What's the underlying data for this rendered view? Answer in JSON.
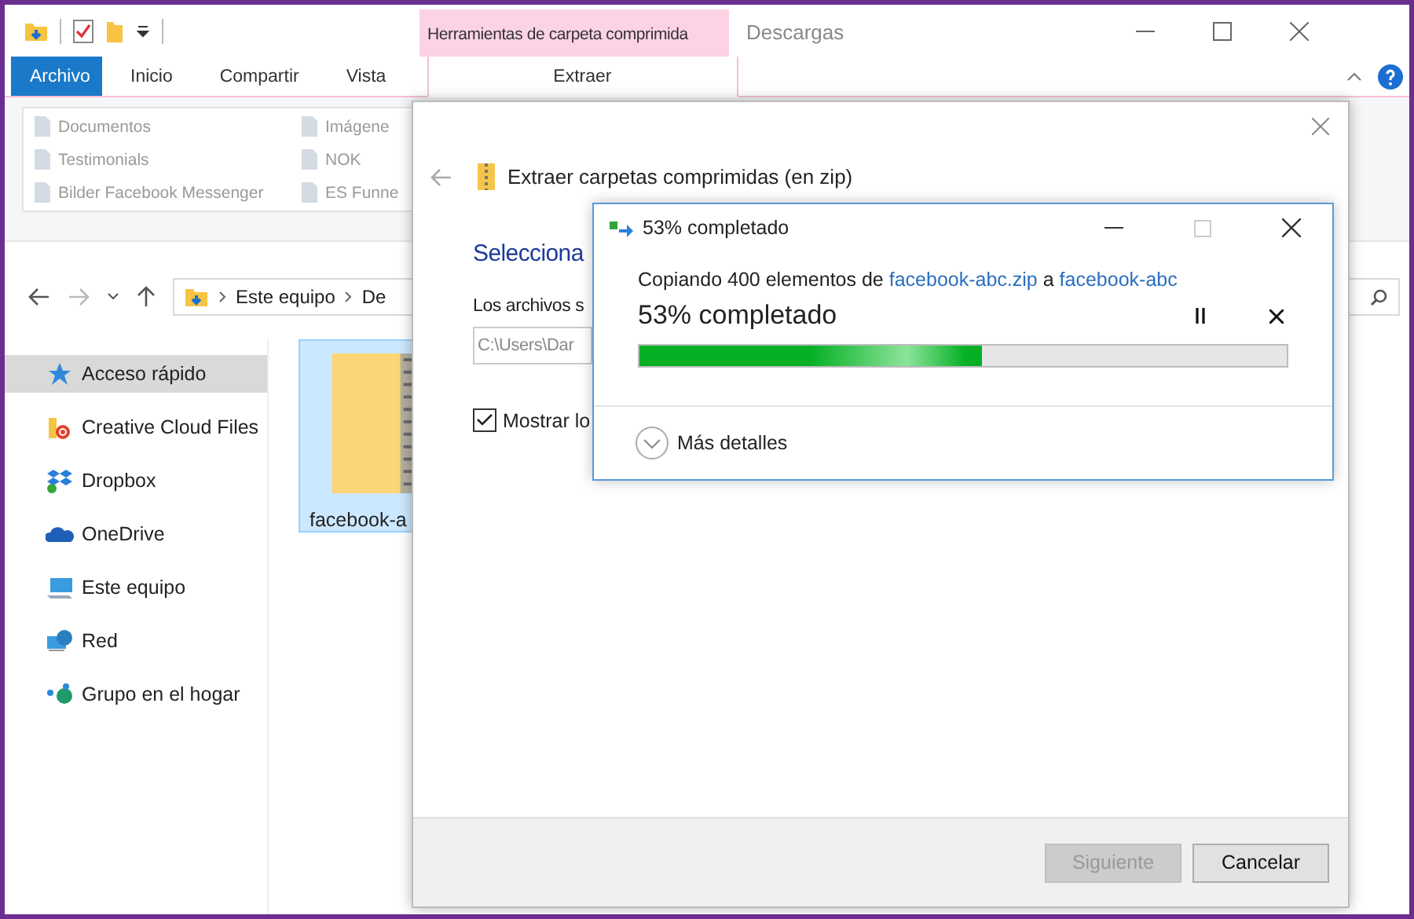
{
  "explorer": {
    "title": "Descargas",
    "context_group": "Herramientas de carpeta comprimida",
    "ribbon_tabs": [
      {
        "label": "Archivo",
        "kind": "file",
        "selected": false
      },
      {
        "label": "Inicio",
        "kind": "normal",
        "selected": false
      },
      {
        "label": "Compartir",
        "kind": "normal",
        "selected": false
      },
      {
        "label": "Vista",
        "kind": "normal",
        "selected": false
      },
      {
        "label": "Extraer",
        "kind": "context",
        "selected": true
      }
    ],
    "quick_links": [
      {
        "label": "Documentos"
      },
      {
        "label": "Imágene"
      },
      {
        "label": "Testimonials"
      },
      {
        "label": "NOK"
      },
      {
        "label": "Bilder Facebook Messenger"
      },
      {
        "label": "ES Funne"
      }
    ],
    "address": {
      "crumbs": [
        "Este equipo",
        "De"
      ]
    },
    "sidebar": {
      "items": [
        {
          "label": "Acceso rápido",
          "selected": true
        },
        {
          "label": "Creative Cloud Files",
          "selected": false
        },
        {
          "label": "Dropbox",
          "selected": false
        },
        {
          "label": "OneDrive",
          "selected": false
        },
        {
          "label": "Este equipo",
          "selected": false
        },
        {
          "label": "Red",
          "selected": false
        },
        {
          "label": "Grupo en el hogar",
          "selected": false
        }
      ]
    },
    "files": [
      {
        "name": "facebook-a",
        "selected": true
      }
    ]
  },
  "wizard": {
    "title": "Extraer carpetas comprimidas (en zip)",
    "heading": "Selecciona",
    "label": "Los archivos s",
    "path_value": "C:\\Users\\Dar",
    "checkbox": {
      "label": "Mostrar lo",
      "checked": true
    },
    "buttons": [
      {
        "label": "Siguiente",
        "disabled": true
      },
      {
        "label": "Cancelar",
        "disabled": false
      }
    ]
  },
  "progress": {
    "title": "53% completado",
    "message": [
      {
        "text": "Copiando 400 elementos de",
        "kind": "plain"
      },
      {
        "text": "facebook-abc.zip",
        "kind": "link"
      },
      {
        "text": "a",
        "kind": "plain"
      },
      {
        "text": "facebook-abc",
        "kind": "link"
      }
    ],
    "status": "53% completado",
    "level": 0.53,
    "details_label": "Más detalles"
  }
}
